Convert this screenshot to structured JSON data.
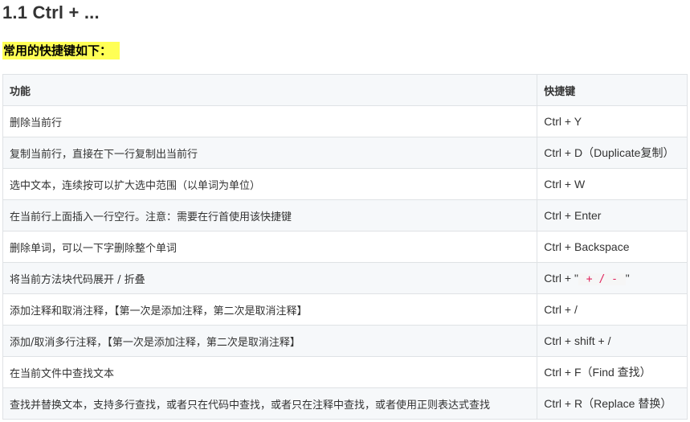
{
  "heading": "1.1 Ctrl + ...",
  "intro": "常用的快捷键如下：",
  "table": {
    "headers": [
      "功能",
      "快捷键"
    ],
    "rows": [
      {
        "func": "删除当前行",
        "key": "Ctrl + Y"
      },
      {
        "func": "复制当前行，直接在下一行复制出当前行",
        "key": "Ctrl + D（Duplicate复制）"
      },
      {
        "func": "选中文本，连续按可以扩大选中范围（以单词为单位）",
        "key": "Ctrl + W"
      },
      {
        "func": "在当前行上面插入一行空行。注意：需要在行首使用该快捷键",
        "key": "Ctrl + Enter"
      },
      {
        "func": "删除单词，可以一下字删除整个单词",
        "key": "Ctrl + Backspace"
      },
      {
        "func": "将当前方法块代码展开 / 折叠",
        "key_prefix": "Ctrl + \"",
        "key_code": " + / - ",
        "key_suffix": "\""
      },
      {
        "func": "添加注释和取消注释，【第一次是添加注释，第二次是取消注释】",
        "key": "Ctrl + /"
      },
      {
        "func": "添加/取消多行注释，【第一次是添加注释，第二次是取消注释】",
        "key": "Ctrl + shift + /"
      },
      {
        "func": "在当前文件中查找文本",
        "key": "Ctrl + F（Find 查找）"
      },
      {
        "func": "查找并替换文本，支持多行查找，或者只在代码中查找，或者只在注释中查找，或者使用正则表达式查找",
        "key": "Ctrl + R（Replace 替换）"
      }
    ]
  }
}
